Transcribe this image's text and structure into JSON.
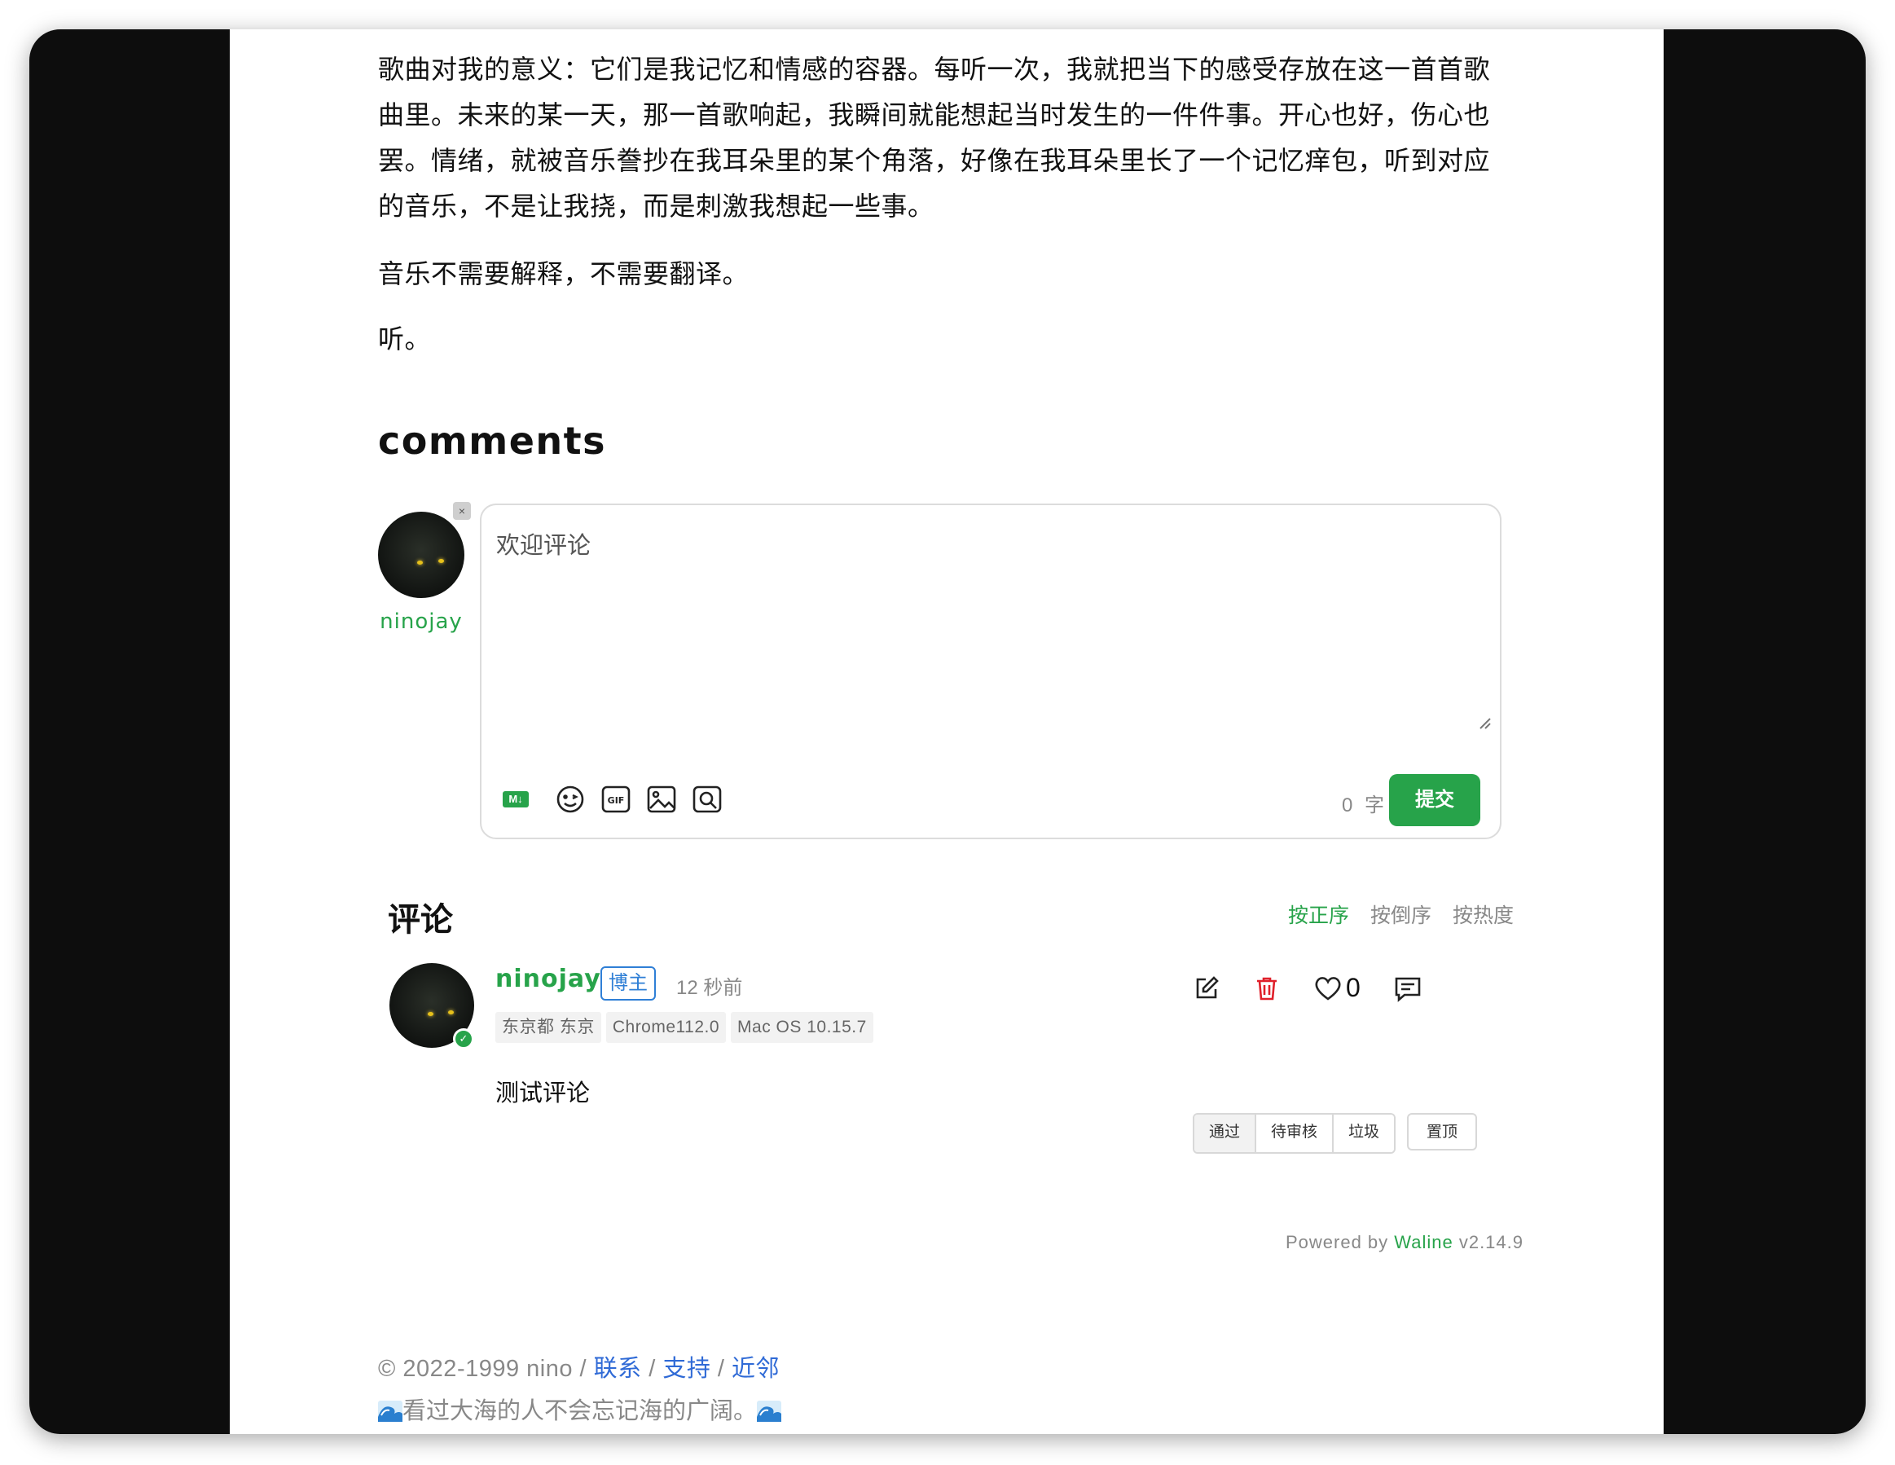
{
  "article": {
    "paragraph1": "歌曲对我的意义：它们是我记忆和情感的容器。每听一次，我就把当下的感受存放在这一首首歌曲里。未来的某一天，那一首歌响起，我瞬间就能想起当时发生的一件件事。开心也好，伤心也罢。情绪，就被音乐誊抄在我耳朵里的某个角落，好像在我耳朵里长了一个记忆痒包，听到对应的音乐，不是让我挠，而是刺激我想起一些事。",
    "paragraph2": "音乐不需要解释，不需要翻译。",
    "paragraph3": "听。"
  },
  "comments_section": {
    "heading": "comments",
    "editor": {
      "username": "ninojay",
      "placeholder": "欢迎评论",
      "remove_label": "×",
      "markdown_label": "M↓",
      "word_count": "0 字",
      "submit_label": "提交",
      "icons": [
        "markdown-icon",
        "emoji-icon",
        "gif-icon",
        "image-icon",
        "preview-icon"
      ]
    },
    "list": {
      "title": "评论",
      "sort_options": [
        "按正序",
        "按倒序",
        "按热度"
      ],
      "active_sort": "按正序",
      "comments": [
        {
          "nick": "ninojay",
          "badge": "博主",
          "time": "12 秒前",
          "meta": [
            "东京都 东京",
            "Chrome112.0",
            "Mac OS 10.15.7"
          ],
          "text": "测试评论",
          "likes": "0",
          "moderation": [
            "通过",
            "待审核",
            "垃圾"
          ],
          "pin_label": "置顶"
        }
      ]
    },
    "powered_prefix": "Powered by ",
    "powered_brand": "Waline",
    "powered_version": " v2.14.9"
  },
  "footer": {
    "copyright": "© 2022-1999 nino / ",
    "links": [
      "联系",
      "支持",
      "近邻"
    ],
    "separator": " / ",
    "tagline": "看过大海的人不会忘记海的广阔。"
  },
  "colors": {
    "accent": "#27a34a",
    "link": "#2f6ad6",
    "delete": "#e0202a"
  }
}
